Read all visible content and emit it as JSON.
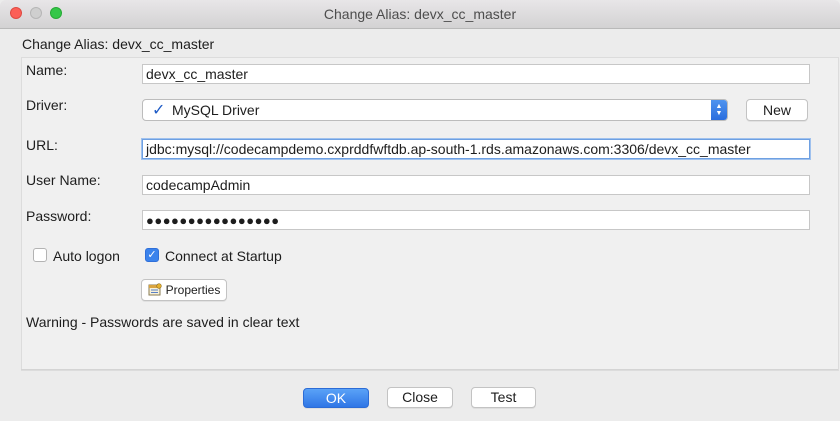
{
  "window": {
    "title": "Change Alias: devx_cc_master"
  },
  "dialog": {
    "header": "Change Alias: devx_cc_master"
  },
  "form": {
    "name_label": "Name:",
    "name_value": "devx_cc_master",
    "driver_label": "Driver:",
    "driver_value": "MySQL Driver",
    "new_button": "New",
    "url_label": "URL:",
    "url_value": "jdbc:mysql://codecampdemo.cxprddfwftdb.ap-south-1.rds.amazonaws.com:3306/devx_cc_master",
    "username_label": "User Name:",
    "username_value": "codecampAdmin",
    "password_label": "Password:",
    "password_value": "●●●●●●●●●●●●●●●●",
    "auto_logon_label": "Auto logon",
    "auto_logon_checked": false,
    "connect_startup_label": "Connect at Startup",
    "connect_startup_checked": true,
    "properties_button": "Properties",
    "warning": "Warning - Passwords are saved in clear text"
  },
  "buttons": {
    "ok": "OK",
    "close": "Close",
    "test": "Test"
  },
  "colors": {
    "accent": "#2f76e6",
    "check": "#1e5bc6"
  }
}
